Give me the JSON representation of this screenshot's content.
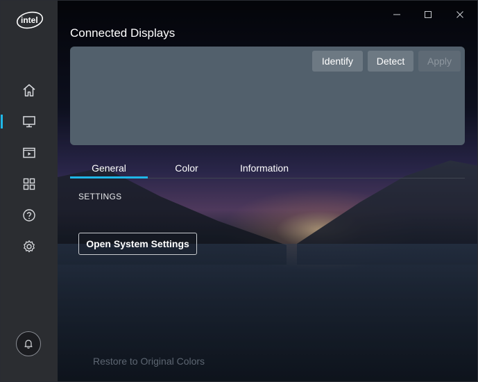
{
  "app": {
    "brand": "intel",
    "title": "Connected Displays"
  },
  "window_controls": {
    "minimize": "minimize-icon",
    "maximize": "maximize-icon",
    "close": "close-icon"
  },
  "sidebar": {
    "items": [
      {
        "name": "home",
        "icon": "home-icon",
        "active": false
      },
      {
        "name": "display",
        "icon": "monitor-icon",
        "active": true
      },
      {
        "name": "video",
        "icon": "video-icon",
        "active": false
      },
      {
        "name": "apps",
        "icon": "grid-icon",
        "active": false
      },
      {
        "name": "help",
        "icon": "help-icon",
        "active": false
      },
      {
        "name": "settings",
        "icon": "gear-icon",
        "active": false
      }
    ],
    "notifications_icon": "bell-icon"
  },
  "displays_panel": {
    "identify_label": "Identify",
    "detect_label": "Detect",
    "apply_label": "Apply"
  },
  "tabs": [
    {
      "label": "General",
      "active": true
    },
    {
      "label": "Color",
      "active": false
    },
    {
      "label": "Information",
      "active": false
    }
  ],
  "settings": {
    "section_label": "SETTINGS",
    "open_system_settings_label": "Open System Settings",
    "restore_label": "Restore to Original Colors"
  },
  "colors": {
    "accent": "#1fb7e8",
    "sidebar_bg": "#2b2d31",
    "panel_bg": "#52606c"
  }
}
